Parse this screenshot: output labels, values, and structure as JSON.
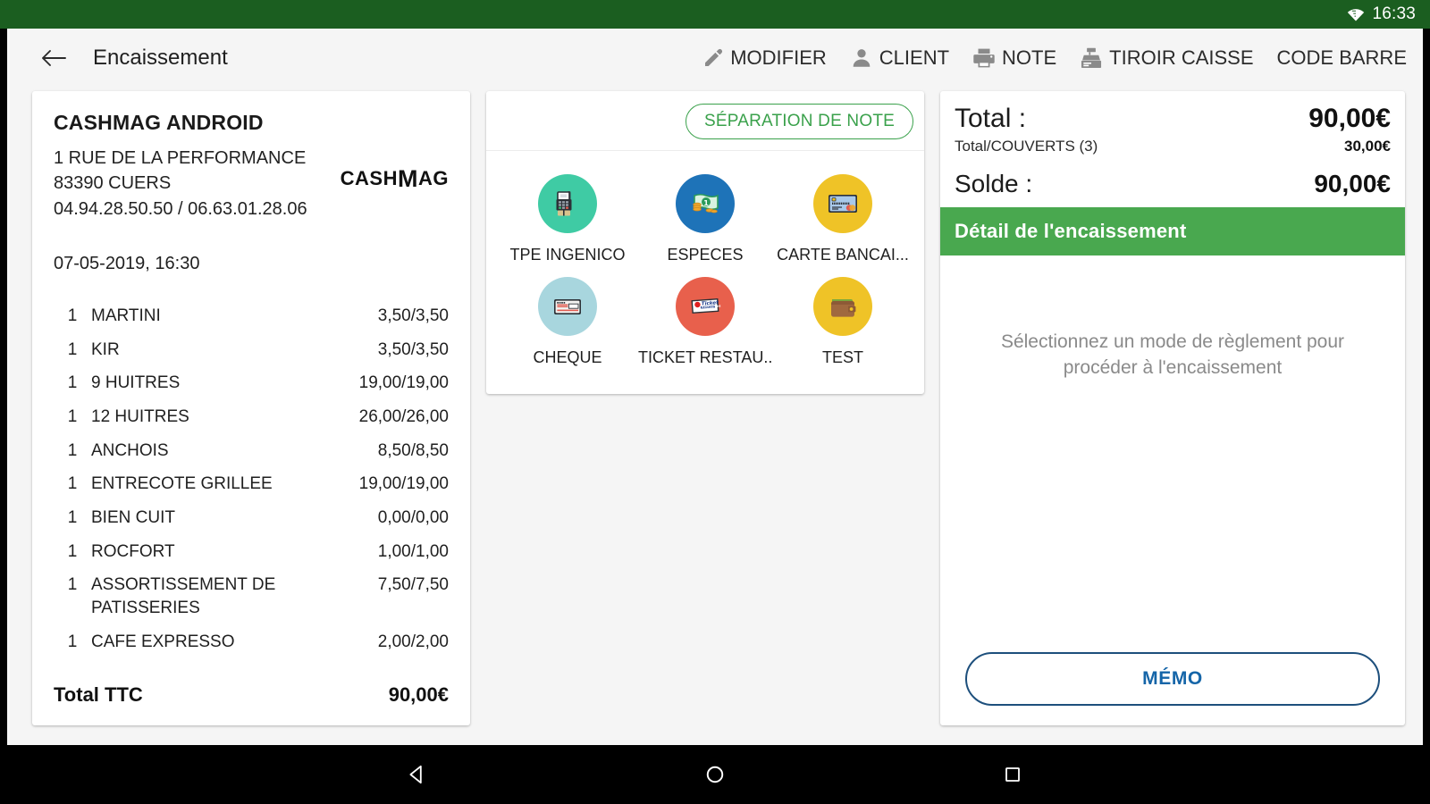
{
  "status_bar": {
    "time": "16:33",
    "wifi_icon": "wifi-icon",
    "bar_color": "#1B5E20"
  },
  "toolbar": {
    "back_icon": "back-arrow-icon",
    "title": "Encaissement",
    "actions": [
      {
        "label": "MODIFIER",
        "icon": "pencil-icon"
      },
      {
        "label": "CLIENT",
        "icon": "person-icon"
      },
      {
        "label": "NOTE",
        "icon": "printer-icon"
      },
      {
        "label": "TIROIR CAISSE",
        "icon": "cash-register-icon"
      },
      {
        "label": "CODE BARRE",
        "icon": ""
      }
    ]
  },
  "receipt": {
    "shop_name": "CASHMAG ANDROID",
    "address_line1": "1 RUE DE LA PERFORMANCE",
    "address_line2": "83390 CUERS",
    "phones": "04.94.28.50.50 / 06.63.01.28.06",
    "logo_part1": "CASH",
    "logo_part2": "M",
    "logo_part3": "AG",
    "datetime": "07-05-2019, 16:30",
    "items": [
      {
        "qty": "1",
        "name": "MARTINI",
        "price": "3,50/3,50"
      },
      {
        "qty": "1",
        "name": "KIR",
        "price": "3,50/3,50"
      },
      {
        "qty": "1",
        "name": "9 HUITRES",
        "price": "19,00/19,00"
      },
      {
        "qty": "1",
        "name": "12 HUITRES",
        "price": "26,00/26,00"
      },
      {
        "qty": "1",
        "name": "ANCHOIS",
        "price": "8,50/8,50"
      },
      {
        "qty": "1",
        "name": "ENTRECOTE GRILLEE",
        "price": "19,00/19,00"
      },
      {
        "qty": "1",
        "name": "BIEN CUIT",
        "price": "0,00/0,00"
      },
      {
        "qty": "1",
        "name": "ROCFORT",
        "price": "1,00/1,00"
      },
      {
        "qty": "1",
        "name": "ASSORTISSEMENT DE PATISSERIES",
        "price": "7,50/7,50"
      },
      {
        "qty": "1",
        "name": "CAFE EXPRESSO",
        "price": "2,00/2,00"
      }
    ],
    "total_label": "Total TTC",
    "total_value": "90,00€"
  },
  "payments": {
    "separation_button": "SÉPARATION DE NOTE",
    "separation_color": "#3aa14b",
    "methods": [
      {
        "label": "TPE INGENICO",
        "icon": "card-terminal-icon",
        "circle_color": "#3FCBA4"
      },
      {
        "label": "ESPECES",
        "icon": "banknote-coins-icon",
        "circle_color": "#1E73B8"
      },
      {
        "label": "CARTE BANCAI...",
        "icon": "credit-card-icon",
        "circle_color": "#EFC327"
      },
      {
        "label": "CHEQUE",
        "icon": "cheque-icon",
        "circle_color": "#A8D6DE"
      },
      {
        "label": "TICKET RESTAU...",
        "icon": "ticket-restaurant-icon",
        "circle_color": "#E8604C"
      },
      {
        "label": "TEST",
        "icon": "wallet-icon",
        "circle_color": "#EFC327"
      }
    ]
  },
  "summary": {
    "total_label": "Total :",
    "total_value": "90,00€",
    "covers_label": "Total/COUVERTS (3)",
    "covers_value": "30,00€",
    "balance_label": "Solde :",
    "balance_value": "90,00€",
    "detail_header": "Détail de l'encaissement",
    "detail_header_color": "#49a84f",
    "empty_message": "Sélectionnez un mode de règlement pour procéder à l'encaissement",
    "memo_label": "MÉMO",
    "memo_color": "#1565a8"
  },
  "nav_bar": {
    "back": "triangle-back-icon",
    "home": "circle-home-icon",
    "recents": "square-recents-icon"
  }
}
